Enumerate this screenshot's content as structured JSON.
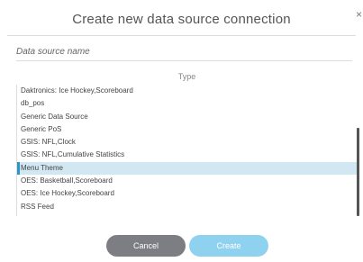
{
  "dialog": {
    "title": "Create new data source connection",
    "close_symbol": "×"
  },
  "name_field": {
    "placeholder": "Data source name",
    "value": ""
  },
  "type_label": "Type",
  "type_list": {
    "items": [
      {
        "label": "Daktronics: Ice Hockey,Scoreboard",
        "selected": false
      },
      {
        "label": "db_pos",
        "selected": false
      },
      {
        "label": "Generic Data Source",
        "selected": false
      },
      {
        "label": "Generic PoS",
        "selected": false
      },
      {
        "label": "GSIS: NFL,Clock",
        "selected": false
      },
      {
        "label": "GSIS: NFL,Cumulative Statistics",
        "selected": false
      },
      {
        "label": "Menu Theme",
        "selected": true
      },
      {
        "label": "OES: Basketball,Scoreboard",
        "selected": false
      },
      {
        "label": "OES: Ice Hockey,Scoreboard",
        "selected": false
      },
      {
        "label": "RSS Feed",
        "selected": false
      }
    ]
  },
  "buttons": {
    "cancel_label": "Cancel",
    "create_label": "Create"
  },
  "colors": {
    "selected_bg": "#d1e8f2",
    "selected_accent": "#2f95c8",
    "cancel_bg": "#7d7e84",
    "create_bg": "#8fd2ef"
  }
}
